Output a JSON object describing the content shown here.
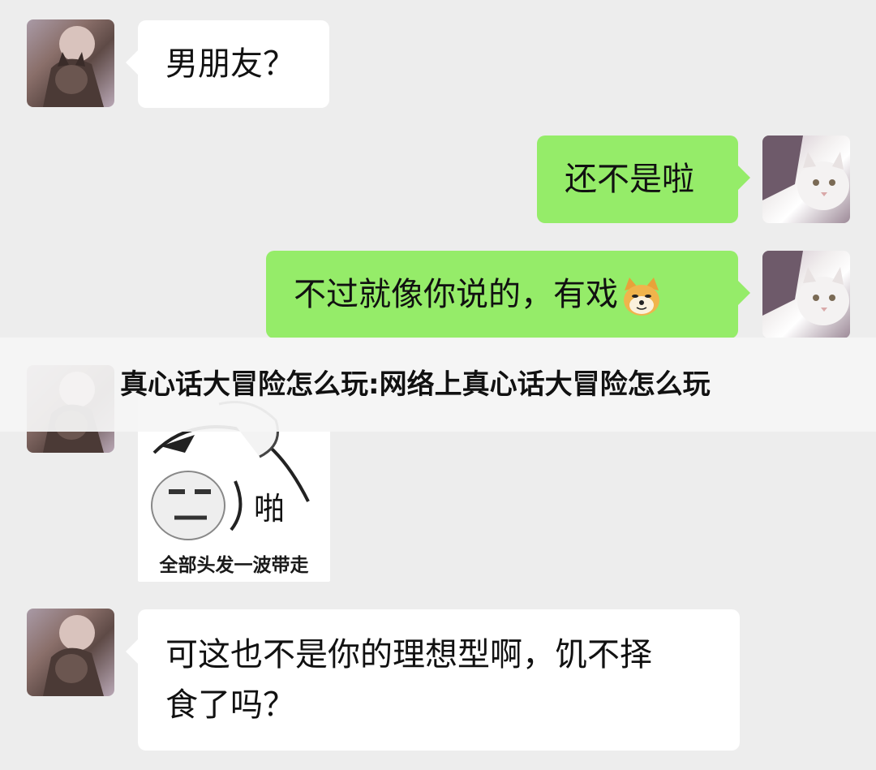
{
  "banner": {
    "title": "真心话大冒险怎么玩:网络上真心话大冒险怎么玩"
  },
  "messages": [
    {
      "side": "left",
      "text": "男朋友？"
    },
    {
      "side": "right",
      "text": "还不是啦"
    },
    {
      "side": "right",
      "text": "不过就像你说的，有戏",
      "emoji": "doge-emoji"
    },
    {
      "side": "left",
      "sticker": {
        "word": "啪",
        "caption": "全部头发一波带走"
      }
    },
    {
      "side": "left",
      "text_line1": "可这也不是你的理想型啊，饥不择",
      "text_line2": "食了吗？"
    }
  ],
  "colors": {
    "background": "#ededed",
    "self_bubble": "#95ec69",
    "other_bubble": "#ffffff"
  }
}
